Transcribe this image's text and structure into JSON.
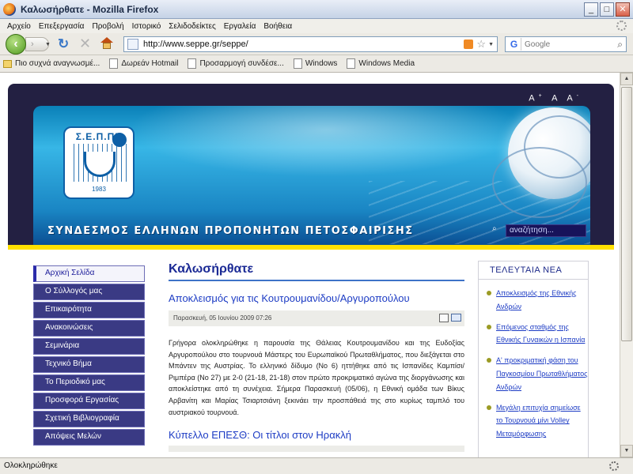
{
  "window": {
    "title": "Καλωσήρθατε - Mozilla Firefox",
    "minimize": "_",
    "maximize": "□",
    "close": "✕"
  },
  "menu": [
    "Αρχείο",
    "Επεξεργασία",
    "Προβολή",
    "Ιστορικό",
    "Σελιδοδείκτες",
    "Εργαλεία",
    "Βοήθεια"
  ],
  "navigation": {
    "url": "http://www.seppe.gr/seppe/",
    "search_placeholder": "Google"
  },
  "bookmarks": [
    "Πιο συχνά αναγνωσμέ...",
    "Δωρεάν Hotmail",
    "Προσαρμογή συνδέσε...",
    "Windows",
    "Windows Media"
  ],
  "site": {
    "font_sizer": "A A A",
    "logo_title": "Σ.Ε.Π.ΠΕ",
    "logo_year": "1983",
    "banner_title": "ΣΥΝΔΕΣΜΟΣ ΕΛΛΗΝΩΝ ΠΡΟΠΟΝΗΤΩΝ ΠΕΤΟΣΦΑΙΡΙΣΗΣ",
    "search_placeholder": "αναζήτηση...",
    "sidebar": [
      "Αρχική Σελίδα",
      "Ο Σύλλογός μας",
      "Επικαιρότητα",
      "Ανακοινώσεις",
      "Σεμινάρια",
      "Τεχνικό Βήμα",
      "Το Περιοδικό μας",
      "Προσφορά Εργασίας",
      "Σχετική Βιβλιογραφία",
      "Απόψεις Μελών"
    ],
    "main_title": "Καλωσήρθατε",
    "article1": {
      "title": "Αποκλεισμός για τις Κουτρουμανίδου/Αργυροπούλου",
      "date": "Παρασκευή, 05 Ιουνίου 2009 07:26",
      "body": "Γρήγορα ολοκληρώθηκε η παρουσία της Θάλειας Κουτρουμανίδου και της Ευδοξίας Αργυροπούλου στο τουρνουά Μάστερς του Ευρωπαϊκού Πρωταθλήματος, που διεξάγεται στο Μπάντεν της Αυστρίας. Το ελληνικό δίδυμο (Νο 6) ηττήθηκε από τις Ισπανίδες Καμπίσι/Ριμπέρα (Νο 27) με 2-0 (21-18, 21-18) στον πρώτο προκριματικό αγώνα της διοργάνωσης και αποκλείστηκε από τη συνέχεια. Σήμερα Παρασκευή (05/06), η Εθνική ομάδα των Βίκυς Αρβανίτη και Μαρίας Τσιαρτσιάνη ξεκινάει την προσπάθειά της στο κυρίως ταμπλό του αυστριακού τουρνουά."
    },
    "article2": {
      "title": "Κύπελλο ΕΠΕΣΘ: Οι τίτλοι στον Ηρακλή"
    },
    "news_header": "ΤΕΛΕΥΤΑΙΑ ΝΕΑ",
    "news": [
      "Αποκλεισμός της Εθνικής Ανδρών",
      "Επόμενος σταθμός της Εθνικής Γυναικών η Ισπανία",
      "Α' προκριματική φάση του Παγκοσμίου Πρωταθλήματος Ανδρών",
      "Μεγάλη επιτυχία σημείωσε το Τουρνουά μίνι Volley Μεταμόρφωσης"
    ]
  },
  "status": "Ολοκληρώθηκε"
}
